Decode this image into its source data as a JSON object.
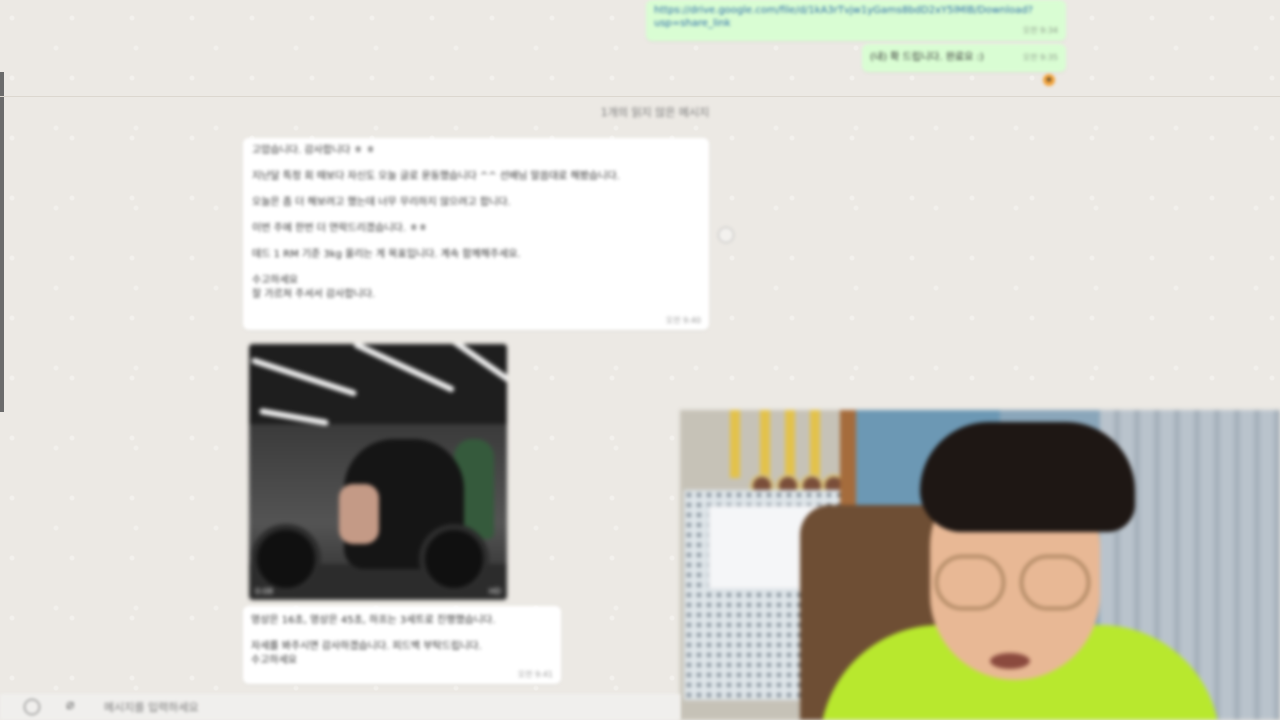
{
  "outgoing": {
    "link_message": "https://drive.google.com/file/d/1kA3rTvjw1yGams8bdD2xY5lMlB/Download?usp=share_link",
    "link_time": "오전 9:34",
    "short_message": "(내) 확 드립니다. 완료요 :)",
    "short_time": "오전 9:35",
    "reaction": "★"
  },
  "unread_divider": "1개의 읽지 않은 메시지",
  "incoming": {
    "lines": [
      "고맙습니다. 감사합니다 ㅎ ㅎ",
      "지난달 특정 회 때보다 자신도 오늘 글로 운동했습니다 ^^ 선배님 말씀대로 해봤습니다.",
      "오늘은 좀 더 해보려고 했는데 너무 무리하지 않으려고 합니다.",
      "이번 주에 한번 더 연락드리겠습니다. ㅎㅎ",
      "데드 1 RM 기준 3kg 올리는 게 목표입니다. 계속 함께해주세요.",
      "수고하세요",
      "잘 가르쳐 주셔서 감사합니다."
    ],
    "time": "오전 9:40",
    "photo_left_label": "0:08",
    "photo_right_label": "HD",
    "caption_lines": [
      "영상은 16초, 영상은 45초, 하프는 3세트로 진행했습니다.",
      "자세를 봐주시면 감사하겠습니다. 피드백 부탁드립니다.",
      "수고하세요"
    ],
    "caption_time": "오전 9:41"
  },
  "composer": {
    "placeholder": "메시지를 입력하세요"
  },
  "icons": {
    "emoji": "emoji-icon",
    "attach": "paperclip-icon",
    "forward": "forward-icon"
  },
  "colors": {
    "outgoing_bubble": "#d9fdd3",
    "incoming_bubble": "#ffffff",
    "chat_background": "#ece9e4",
    "shirt": "#b8e82e"
  }
}
